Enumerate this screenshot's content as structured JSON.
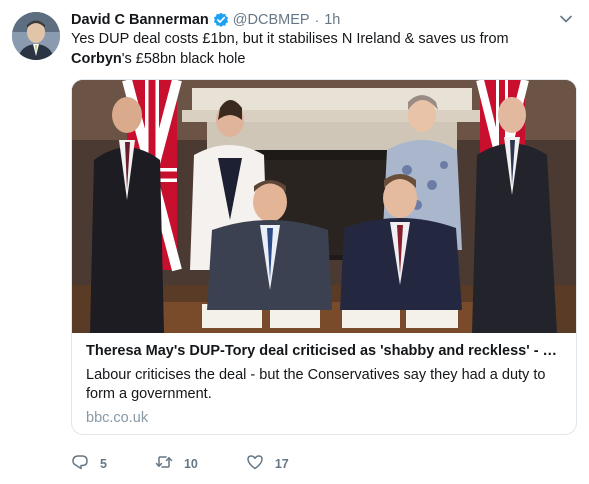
{
  "author": {
    "display_name": "David C Bannerman",
    "handle": "@DCBMEP",
    "time": "1h"
  },
  "tweet": {
    "text_line1": "Yes DUP deal costs £1bn, but it stabilises N Ireland & saves us from",
    "text_bold": "Corbyn",
    "text_rest": "'s £58bn black hole"
  },
  "card": {
    "title": "Theresa May's DUP-Tory deal criticised as 'shabby and reckless' - …",
    "description": "Labour criticises the deal - but the Conservatives say they had a duty to form a government.",
    "domain": "bbc.co.uk"
  },
  "actions": {
    "replies": "5",
    "retweets": "10",
    "likes": "17"
  },
  "colors": {
    "verified": "#1da1f2",
    "secondary_text": "#657786",
    "domain_text": "#8899a6",
    "border": "#e1e8ed"
  },
  "icons": [
    "verified-badge-icon",
    "chevron-down-icon",
    "reply-icon",
    "retweet-icon",
    "like-icon"
  ]
}
